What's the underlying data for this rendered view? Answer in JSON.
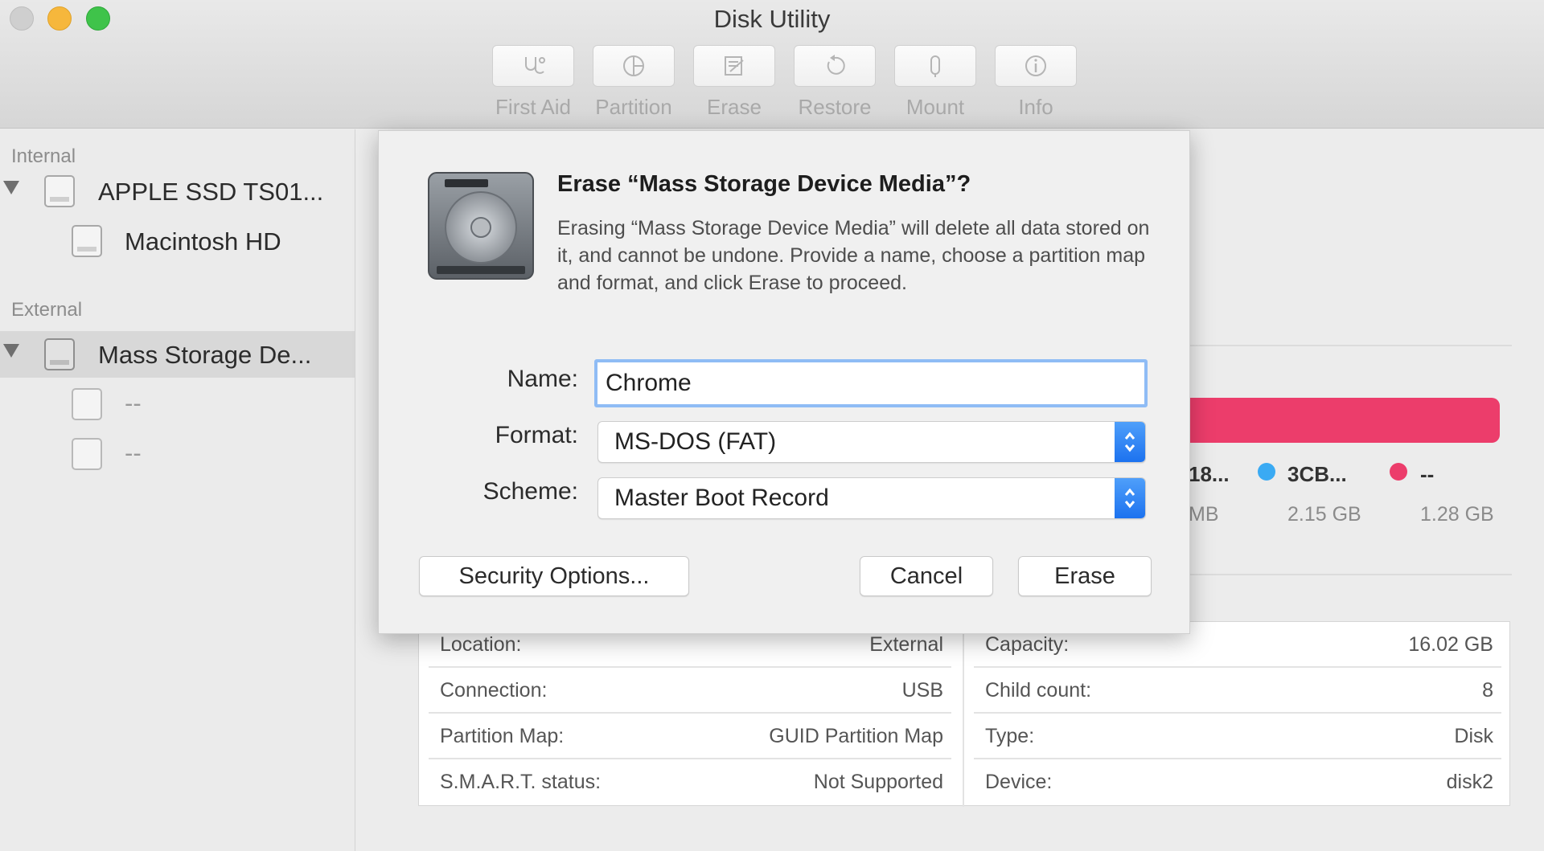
{
  "window": {
    "title": "Disk Utility"
  },
  "toolbar": {
    "items": [
      {
        "label": "First Aid",
        "icon": "stethoscope-icon"
      },
      {
        "label": "Partition",
        "icon": "pie-icon"
      },
      {
        "label": "Erase",
        "icon": "erase-icon"
      },
      {
        "label": "Restore",
        "icon": "restore-icon"
      },
      {
        "label": "Mount",
        "icon": "mount-icon"
      },
      {
        "label": "Info",
        "icon": "info-icon"
      }
    ]
  },
  "sidebar": {
    "internal_header": "Internal",
    "external_header": "External",
    "internal_items": [
      {
        "label": "APPLE SSD TS01...",
        "level": 0
      },
      {
        "label": "Macintosh HD",
        "level": 1
      }
    ],
    "external_items": [
      {
        "label": "Mass Storage De...",
        "level": 0,
        "selected": true
      },
      {
        "label": "--",
        "level": 1
      },
      {
        "label": "--",
        "level": 1
      }
    ]
  },
  "usage": {
    "bar_color": "#ec3d6b",
    "legend": [
      {
        "name": "18...",
        "size": "MB",
        "color": ""
      },
      {
        "name": "3CB...",
        "size": "2.15 GB",
        "color": "#3aaaf3"
      },
      {
        "name": "--",
        "size": "1.28 GB",
        "color": "#ec3d6b"
      }
    ]
  },
  "info": {
    "left": [
      {
        "key": "Location:",
        "value": "External"
      },
      {
        "key": "Connection:",
        "value": "USB"
      },
      {
        "key": "Partition Map:",
        "value": "GUID Partition Map"
      },
      {
        "key": "S.M.A.R.T. status:",
        "value": "Not Supported"
      }
    ],
    "right": [
      {
        "key": "Capacity:",
        "value": "16.02 GB"
      },
      {
        "key": "Child count:",
        "value": "8"
      },
      {
        "key": "Type:",
        "value": "Disk"
      },
      {
        "key": "Device:",
        "value": "disk2"
      }
    ]
  },
  "dialog": {
    "title": "Erase “Mass Storage Device Media”?",
    "message": "Erasing “Mass Storage Device Media” will delete all data stored on it, and cannot be undone. Provide a name, choose a partition map and format, and click Erase to proceed.",
    "name_label": "Name:",
    "name_value": "Chrome",
    "format_label": "Format:",
    "format_value": "MS-DOS (FAT)",
    "scheme_label": "Scheme:",
    "scheme_value": "Master Boot Record",
    "security_button": "Security Options...",
    "cancel_button": "Cancel",
    "erase_button": "Erase",
    "accent_color": "#1c72ef"
  }
}
